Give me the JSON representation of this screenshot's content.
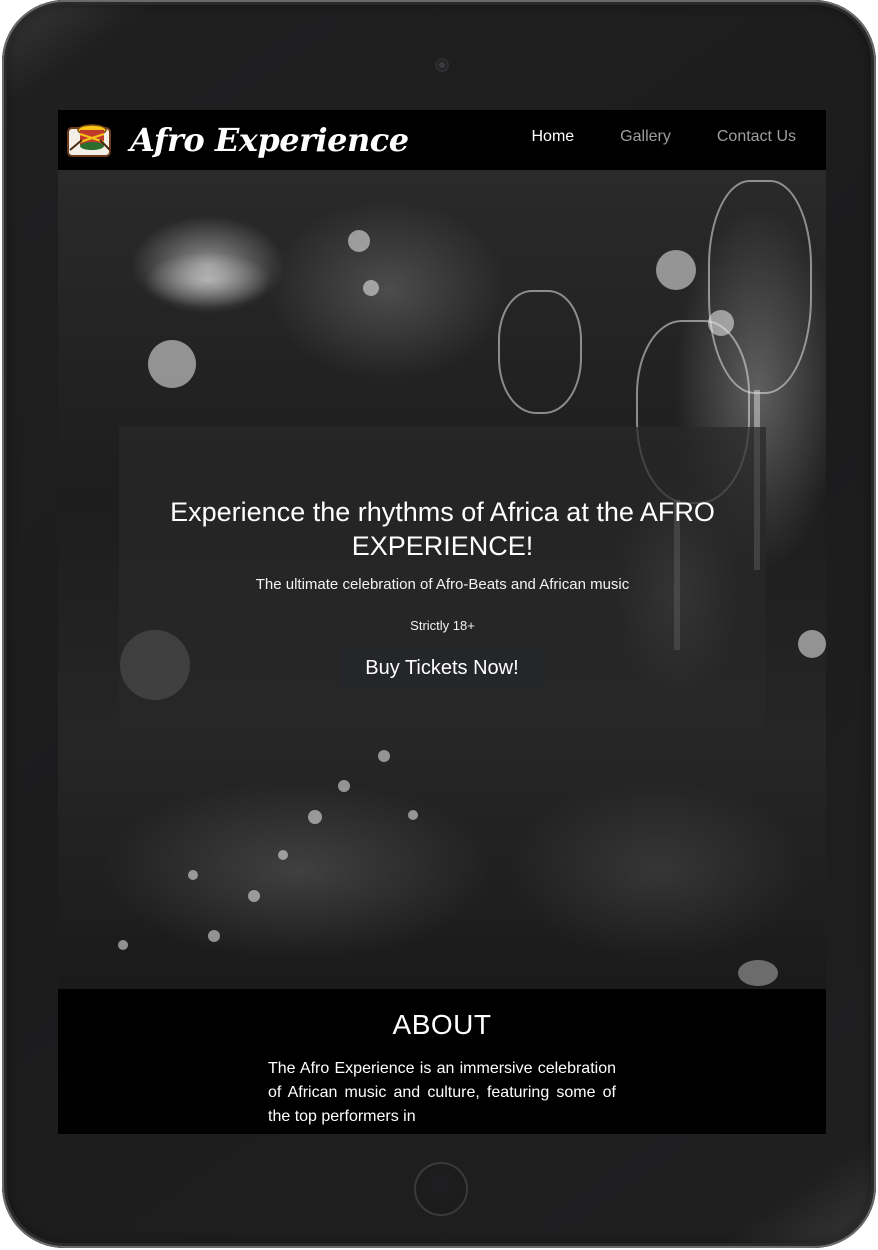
{
  "nav": {
    "brand": "Afro Experience",
    "links": [
      {
        "label": "Home",
        "active": true
      },
      {
        "label": "Gallery",
        "active": false
      },
      {
        "label": "Contact Us",
        "active": false
      }
    ]
  },
  "hero": {
    "title": "Experience the rhythms of Africa at the AFRO EXPERIENCE!",
    "subtitle": "The ultimate celebration of Afro-Beats and African music",
    "age_notice": "Strictly 18+",
    "cta_label": "Buy Tickets Now!"
  },
  "about": {
    "heading": "ABOUT",
    "body": "The Afro Experience is an immersive celebration of African music and culture, featuring some of the top performers in"
  },
  "colors": {
    "page_bg": "#000000",
    "nav_active": "#ffffff",
    "nav_inactive": "#9e9e9e",
    "cta_bg": "#242629"
  }
}
